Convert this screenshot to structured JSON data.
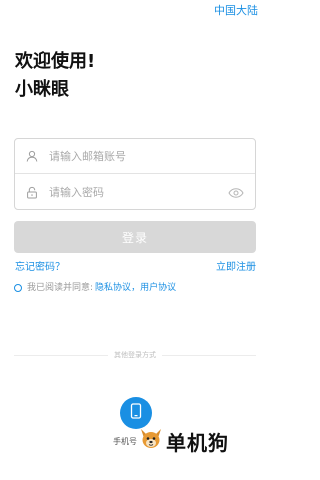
{
  "header": {
    "region_label": "中国大陆"
  },
  "intro": {
    "welcome": "欢迎使用!",
    "app_name": "小眯眼"
  },
  "form": {
    "email_placeholder": "请输入邮箱账号",
    "password_placeholder": "请输入密码",
    "email_icon": "user-icon",
    "password_icon": "lock-icon",
    "visibility_icon": "eye-icon"
  },
  "login": {
    "label": "登录"
  },
  "links": {
    "forgot": "忘记密码？",
    "register": "立即注册"
  },
  "agreement": {
    "prefix": "我已阅读并同意:",
    "privacy": "隐私协议",
    "separator": "，",
    "user": "用户协议"
  },
  "other_login": {
    "divider_text": "其他登录方式",
    "phone_label": "手机号",
    "phone_icon": "phone-icon"
  },
  "watermark": {
    "text": "单机狗"
  },
  "colors": {
    "accent": "#1a8fe3",
    "button_disabled": "#d8d8d8"
  }
}
